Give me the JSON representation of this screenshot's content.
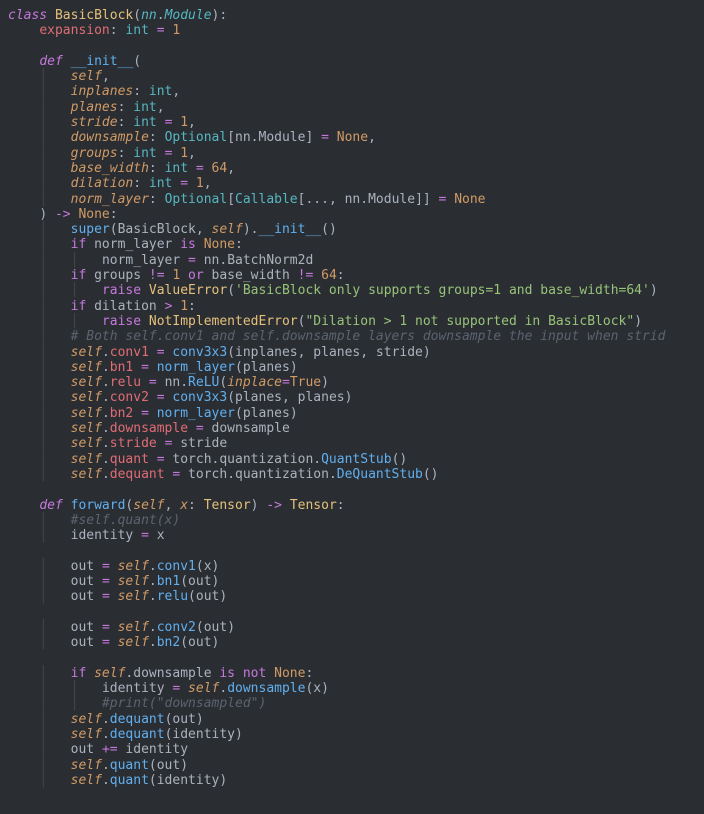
{
  "code": {
    "class_kw": "class",
    "class_name": "BasicBlock",
    "base_ns": "nn",
    "base_cls": "Module",
    "expansion_name": "expansion",
    "int_t": "int",
    "one": "1",
    "def_kw": "def",
    "init_name": "__init__",
    "self": "self",
    "p_inplanes": "inplanes",
    "p_planes": "planes",
    "p_stride": "stride",
    "p_downsample": "downsample",
    "Optional": "Optional",
    "nn": "nn",
    "Module_t": "Module",
    "none_kw": "None",
    "p_groups": "groups",
    "p_base_width": "base_width",
    "num64": "64",
    "p_dilation": "dilation",
    "p_norm_layer": "norm_layer",
    "Callable": "Callable",
    "ellipsis": "...",
    "arrow": "->",
    "super_fn": "super",
    "init_dunder": "__init__",
    "if_kw": "if",
    "is_kw": "is",
    "BatchNorm2d": "BatchNorm2d",
    "or_kw": "or",
    "ne": "!=",
    "raise_kw": "raise",
    "ValueError": "ValueError",
    "err_groups": "'BasicBlock only supports groups=1 and base_width=64'",
    "gt": ">",
    "NotImplementedError": "NotImplementedError",
    "err_dilation": "\"Dilation > 1 not supported in BasicBlock\"",
    "cmt_downsample": "# Both self.conv1 and self.downsample layers downsample the input when strid",
    "conv1": "conv1",
    "conv3x3": "conv3x3",
    "bn1": "bn1",
    "relu_attr": "relu",
    "ReLU": "ReLU",
    "inplace": "inplace",
    "true_kw": "True",
    "conv2": "conv2",
    "bn2": "bn2",
    "downsample_attr": "downsample",
    "stride_attr": "stride",
    "quant_attr": "quant",
    "torch": "torch",
    "quantization": "quantization",
    "QuantStub": "QuantStub",
    "dequant_attr": "dequant",
    "DeQuantStub": "DeQuantStub",
    "forward_name": "forward",
    "x_param": "x",
    "Tensor": "Tensor",
    "cmt_quantx": "#self.quant(x)",
    "identity": "identity",
    "out": "out",
    "not_kw": "not",
    "cmt_printds": "#print(\"downsampled\")",
    "plus_eq": "+=",
    "eq": "="
  }
}
